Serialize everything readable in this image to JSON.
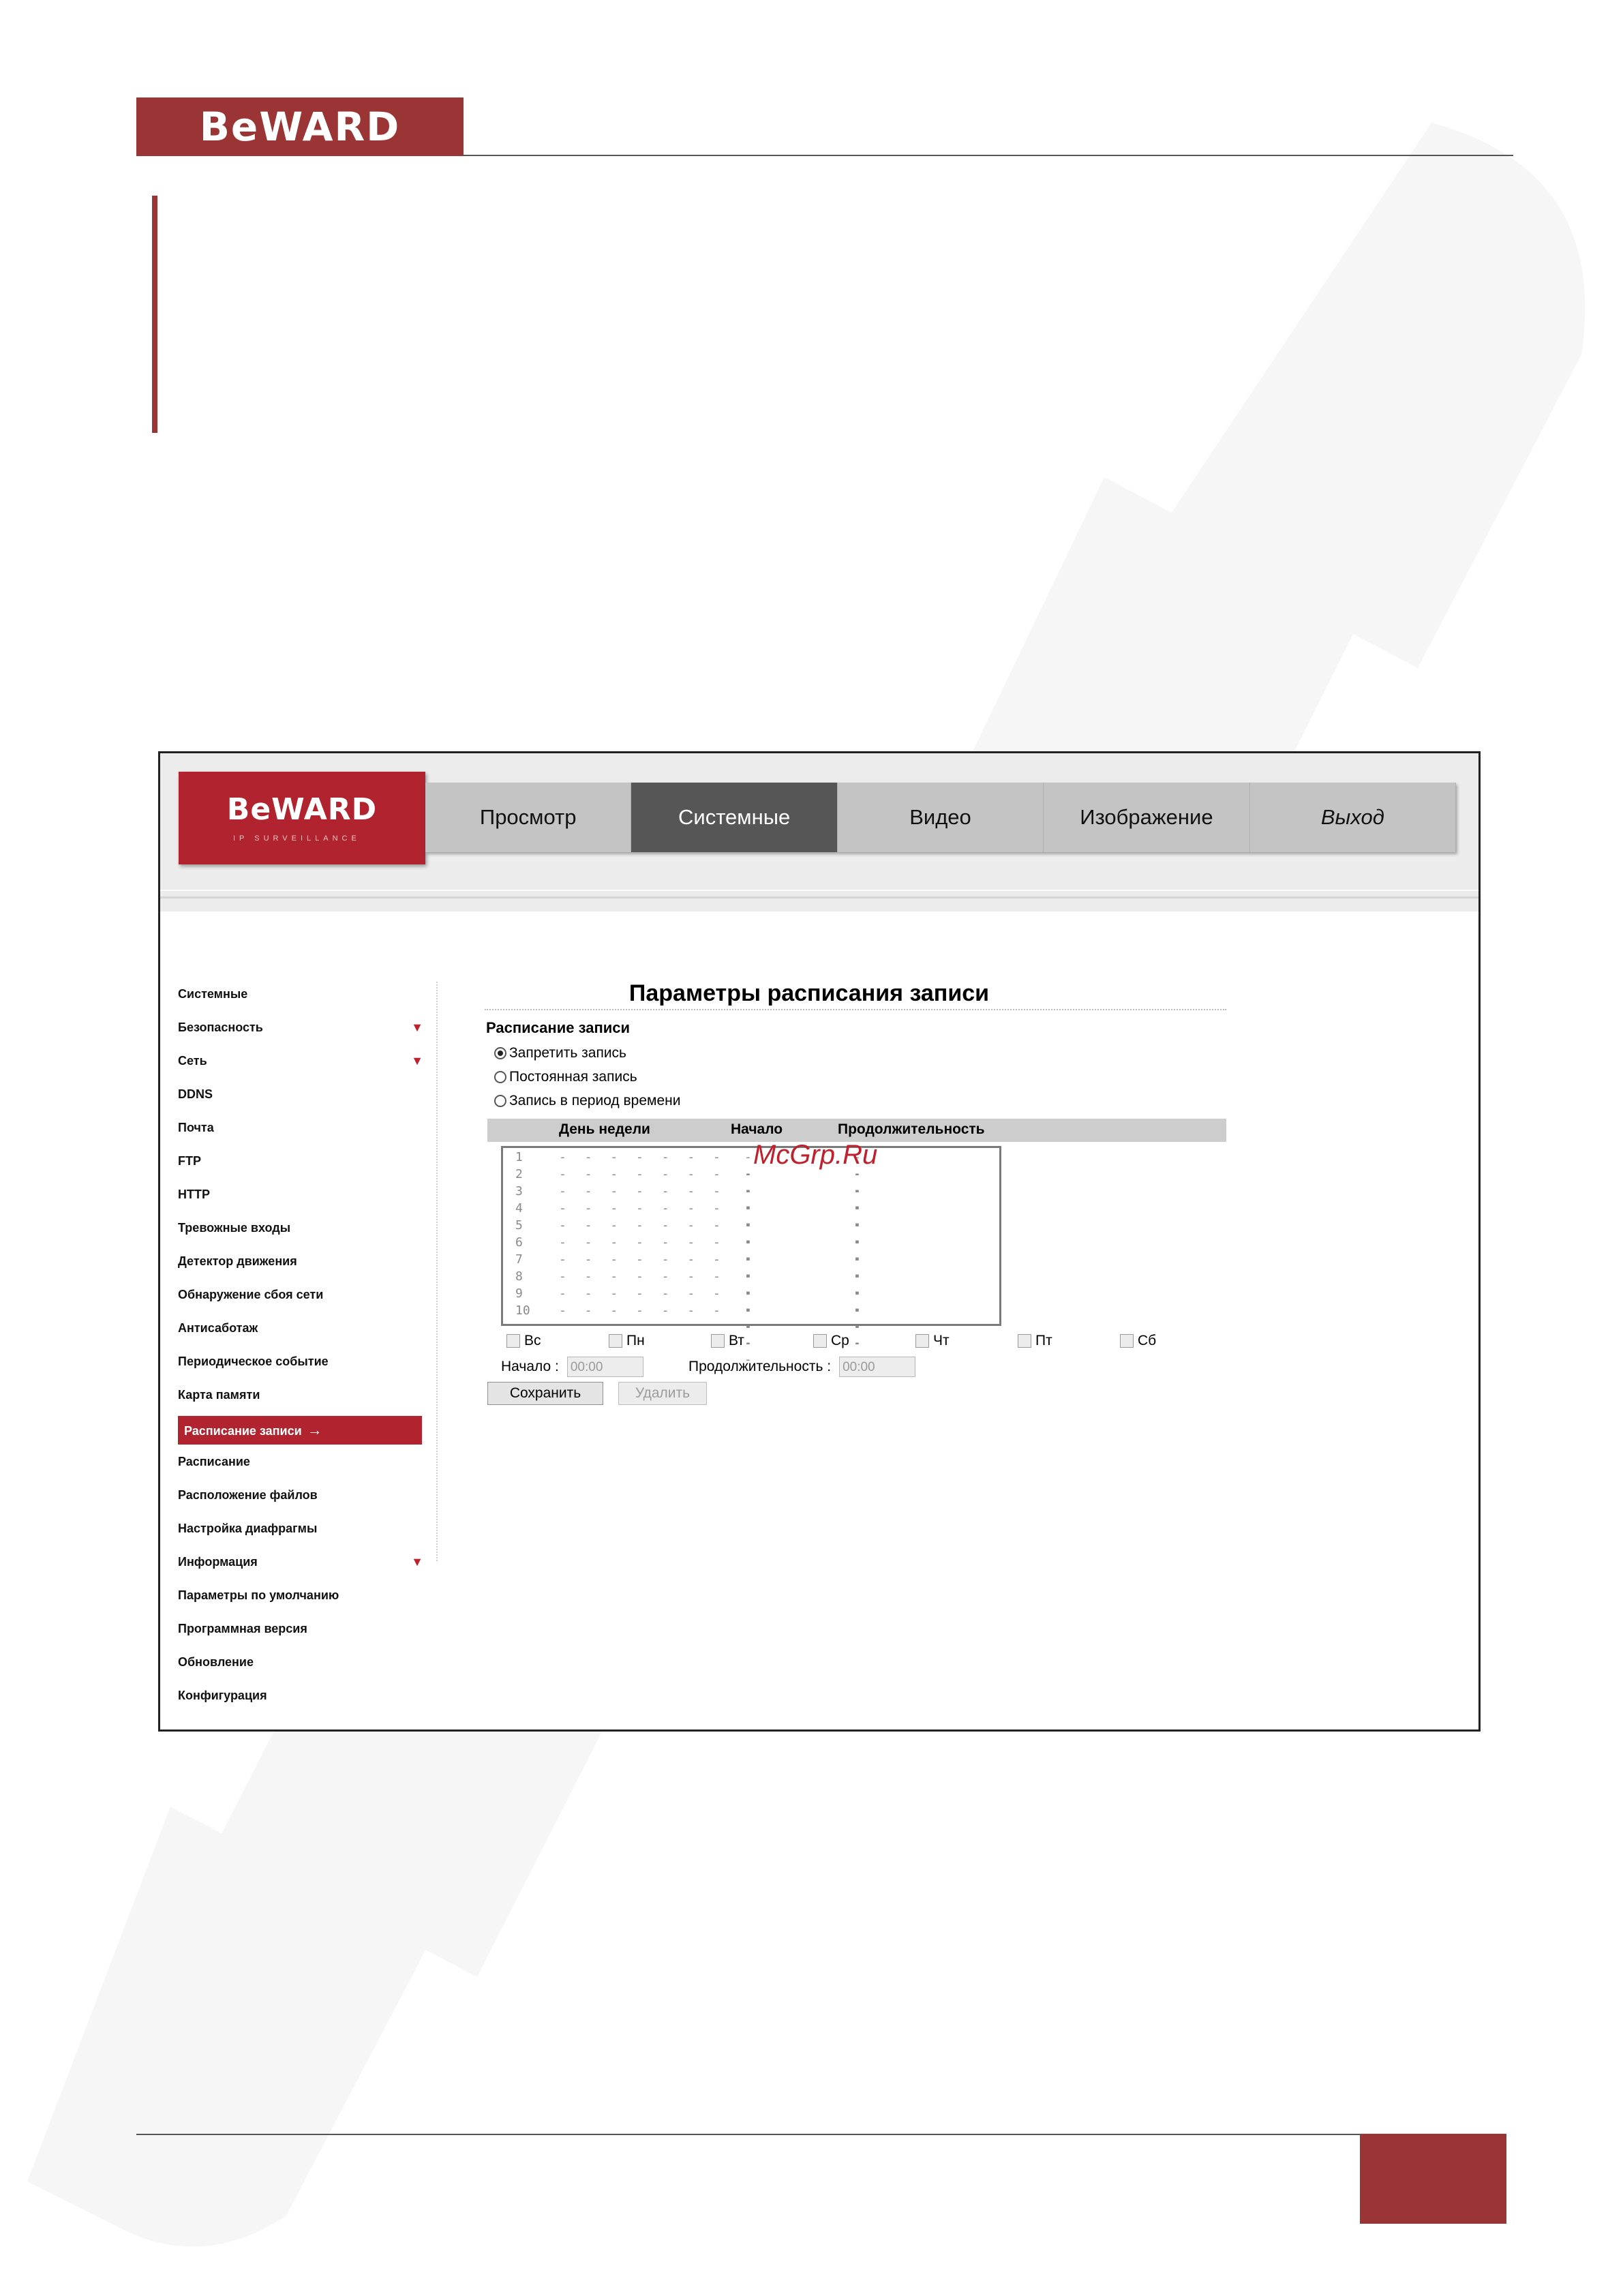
{
  "document": {
    "logo": "BeWARD"
  },
  "app": {
    "logo": "BeWARD",
    "logo_tagline": "IP SURVEILLANCE",
    "nav": [
      {
        "label": "Просмотр"
      },
      {
        "label": "Системные",
        "active": true
      },
      {
        "label": "Видео"
      },
      {
        "label": "Изображение"
      },
      {
        "label": "Выход"
      }
    ]
  },
  "sidebar": {
    "items": [
      {
        "label": "Системные"
      },
      {
        "label": "Безопасность",
        "expandable": true
      },
      {
        "label": "Сеть",
        "expandable": true
      },
      {
        "label": "DDNS"
      },
      {
        "label": "Почта"
      },
      {
        "label": "FTP"
      },
      {
        "label": "HTTP"
      },
      {
        "label": "Тревожные входы"
      },
      {
        "label": "Детектор движения"
      },
      {
        "label": "Обнаружение сбоя сети"
      },
      {
        "label": "Антисаботаж"
      },
      {
        "label": "Периодическое событие"
      },
      {
        "label": "Карта памяти"
      },
      {
        "label": "Расписание записи",
        "active": true
      },
      {
        "label": "Расписание"
      },
      {
        "label": "Расположение файлов"
      },
      {
        "label": "Настройка диафрагмы"
      },
      {
        "label": "Информация",
        "expandable": true
      },
      {
        "label": "Параметры по умолчанию"
      },
      {
        "label": "Программная версия"
      },
      {
        "label": "Обновление"
      },
      {
        "label": "Конфигурация"
      }
    ],
    "active_arrow": "→"
  },
  "main": {
    "title": "Параметры расписания записи",
    "section": "Расписание записи",
    "radios": [
      {
        "label": "Запретить запись",
        "checked": true
      },
      {
        "label": "Постоянная запись",
        "checked": false
      },
      {
        "label": "Запись в период времени",
        "checked": false
      }
    ],
    "table_headers": {
      "day": "День недели",
      "start": "Начало",
      "duration": "Продолжительность"
    },
    "rows": [
      {
        "n": "1",
        "days": "- - - - - - -",
        "start": "----",
        "duration": "----"
      },
      {
        "n": "2",
        "days": "- - - - - - -",
        "start": "----",
        "duration": "----"
      },
      {
        "n": "3",
        "days": "- - - - - - -",
        "start": "----",
        "duration": "----"
      },
      {
        "n": "4",
        "days": "- - - - - - -",
        "start": "----",
        "duration": "----"
      },
      {
        "n": "5",
        "days": "- - - - - - -",
        "start": "----",
        "duration": "----"
      },
      {
        "n": "6",
        "days": "- - - - - - -",
        "start": "----",
        "duration": "----"
      },
      {
        "n": "7",
        "days": "- - - - - - -",
        "start": "----",
        "duration": "----"
      },
      {
        "n": "8",
        "days": "- - - - - - -",
        "start": "----",
        "duration": "----"
      },
      {
        "n": "9",
        "days": "- - - - - - -",
        "start": "----",
        "duration": "----"
      },
      {
        "n": "10",
        "days": "- - - - - - -",
        "start": "----",
        "duration": "----"
      }
    ],
    "days": [
      "Вс",
      "Пн",
      "Вт",
      "Ср",
      "Чт",
      "Пт",
      "Сб"
    ],
    "start_label": "Начало :",
    "start_value": "00:00",
    "duration_label": "Продолжительность :",
    "duration_value": "00:00",
    "save_label": "Сохранить",
    "delete_label": "Удалить"
  },
  "overlay_text": "McGrp.Ru",
  "colors": {
    "brand": "#9b3535",
    "app_red": "#b1242f",
    "active_tab": "#565656"
  }
}
